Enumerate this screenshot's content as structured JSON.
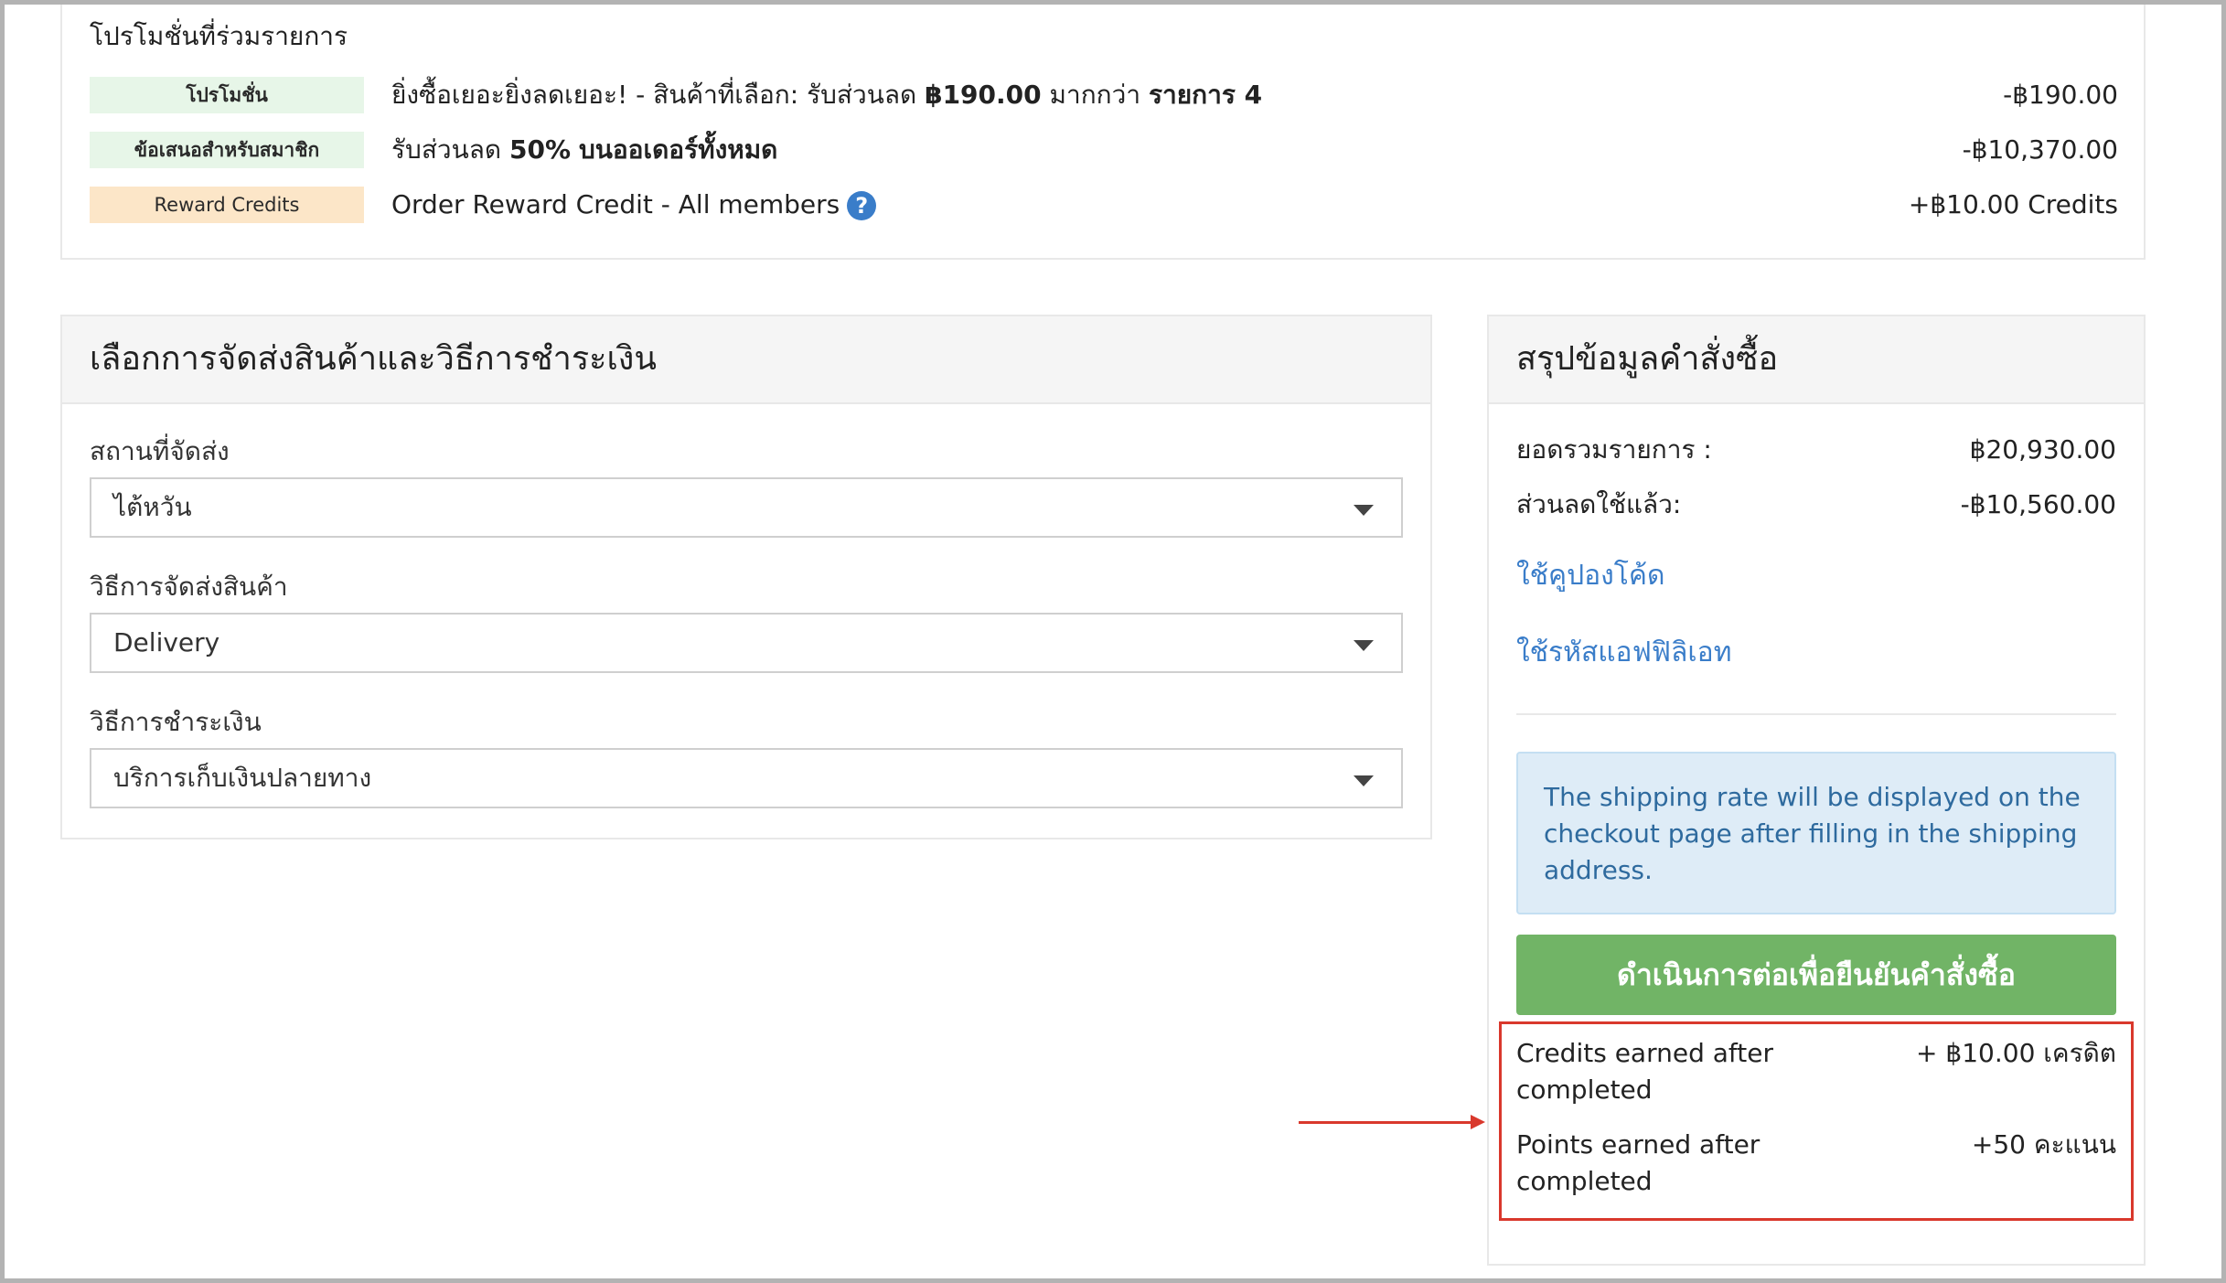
{
  "promotions": {
    "title": "โปรโมชั่นที่ร่วมรายการ",
    "rows": [
      {
        "badge": "โปรโมชั่น",
        "desc_plain1": "ยิ่งซื้อเยอะยิ่งลดเยอะ! - สินค้าที่เลือก: รับส่วนลด ",
        "desc_bold1": "฿190.00",
        "desc_plain2": " มากกว่า ",
        "desc_bold2": "รายการ 4",
        "amount": "-฿190.00"
      },
      {
        "badge": "ข้อเสนอสำหรับสมาชิก",
        "desc_plain1": "รับส่วนลด ",
        "desc_bold1": "50%",
        "desc_plain2": " ",
        "desc_bold2": "บนออเดอร์ทั้งหมด",
        "amount": "-฿10,370.00"
      },
      {
        "badge": "Reward Credits",
        "desc_plain1": "Order Reward Credit - All members",
        "help_icon": "?",
        "amount": "+฿10.00 Credits"
      }
    ]
  },
  "shipping_panel": {
    "title": "เลือกการจัดส่งสินค้าและวิธีการชำระเงิน",
    "location_label": "สถานที่จัดส่ง",
    "location_value": "ไต้หวัน",
    "method_label": "วิธีการจัดส่งสินค้า",
    "method_value": "Delivery",
    "payment_label": "วิธีการชำระเงิน",
    "payment_value": "บริการเก็บเงินปลายทาง"
  },
  "summary_panel": {
    "title": "สรุปข้อมูลคำสั่งซื้อ",
    "subtotal_label": "ยอดรวมรายการ :",
    "subtotal_value": "฿20,930.00",
    "discount_label": "ส่วนลดใช้แล้ว:",
    "discount_value": "-฿10,560.00",
    "coupon_link": "ใช้คูปองโค้ด",
    "affiliate_link": "ใช้รหัสแอฟฟิลิเอท",
    "info_text": "The shipping rate will be displayed on the checkout page after filling in the shipping address.",
    "cta_label": "ดำเนินการต่อเพื่อยืนยันคำสั่งซื้อ",
    "credits_label": "Credits earned after completed",
    "credits_value": "+ ฿10.00 เครดิต",
    "points_label": "Points earned after completed",
    "points_value": "+50 คะแนน"
  },
  "colors": {
    "accent_green": "#71b466",
    "link_blue": "#3a7dc9",
    "highlight_red": "#d9382c",
    "info_bg": "#deecf7"
  }
}
